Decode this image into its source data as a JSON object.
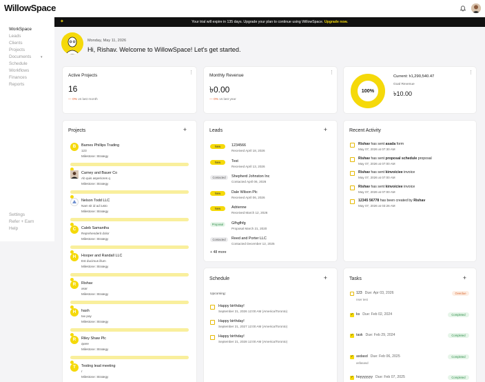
{
  "app": {
    "logo": "WillowSpace"
  },
  "banner": {
    "text": "Your trial will expire in 135 days. Upgrade your plan to continue using WillowSpace.",
    "link": "Upgrade now."
  },
  "sidebar": {
    "items": [
      {
        "label": "WorkSpace"
      },
      {
        "label": "Leads"
      },
      {
        "label": "Clients"
      },
      {
        "label": "Projects"
      },
      {
        "label": "Documents"
      },
      {
        "label": "Schedule"
      },
      {
        "label": "Workflows"
      },
      {
        "label": "Finances"
      },
      {
        "label": "Reports"
      }
    ],
    "bottom": [
      {
        "label": "Settings"
      },
      {
        "label": "Refer + Earn"
      },
      {
        "label": "Help"
      }
    ]
  },
  "welcome": {
    "date": "Monday, May 11, 2026",
    "greeting": "Hi, Rishav. Welcome to WillowSpace! Let's get started."
  },
  "active_projects": {
    "title": "Active Projects",
    "value": "16",
    "delta": "0%",
    "delta_label": "vs last month"
  },
  "monthly_revenue": {
    "title": "Monthly Revenue",
    "value": "৳0.00",
    "delta": "0%",
    "delta_label": "vs last year"
  },
  "goal": {
    "percent_label": "100%",
    "progress": 1.0,
    "current_label": "Current: ৳1,290,540.47",
    "goal_label": "Goal Revenue",
    "goal_value": "৳10.00"
  },
  "projects": {
    "title": "Projects",
    "items": [
      {
        "initial": "B",
        "name": "Barnes Phillips Trading",
        "sub": "123",
        "milestone": "Milestone: Strategy",
        "avatar": "initial"
      },
      {
        "initial": "",
        "name": "Carney and Bauer Co",
        "sub": "Ab quis asperiores q",
        "milestone": "Milestone: Strategy",
        "avatar": "photo"
      },
      {
        "initial": "",
        "name": "Nelson Todd LLC",
        "sub": "Nam sit id ad iusto",
        "milestone": "Milestone: Strategy",
        "avatar": "logo"
      },
      {
        "initial": "C",
        "name": "Caleb Samantha",
        "sub": "Reprehenderit dolor",
        "milestone": "Milestone: Strategy",
        "avatar": "initial"
      },
      {
        "initial": "H",
        "name": "Hooper and Randall LLC",
        "sub": "Est ducimus illum",
        "milestone": "Milestone: Strategy",
        "avatar": "initial"
      },
      {
        "initial": "R",
        "name": "Rishav",
        "sub": "asar",
        "milestone": "Milestone: Strategy",
        "avatar": "initial"
      },
      {
        "initial": "H",
        "name": "hash",
        "sub": "tax pay",
        "milestone": "Milestone: Strategy",
        "avatar": "initial"
      },
      {
        "initial": "R",
        "name": "Riley Shaw Plc",
        "sub": "qwee",
        "milestone": "Milestone: Strategy",
        "avatar": "initial"
      },
      {
        "initial": "T",
        "name": "Testing lead meeting",
        "sub": "r",
        "milestone": "Milestone: Strategy",
        "avatar": "initial"
      }
    ]
  },
  "leads": {
    "title": "Leads",
    "more": "+ 48 more",
    "items": [
      {
        "status": "New",
        "kind": "new",
        "name": "1234566",
        "sub": "Received April 18, 2026"
      },
      {
        "status": "New",
        "kind": "new",
        "name": "Test",
        "sub": "Received April 13, 2026"
      },
      {
        "status": "Contacted",
        "kind": "contacted",
        "name": "Shepherd Johnston Inc",
        "sub": "Contacted April 06, 2026"
      },
      {
        "status": "New",
        "kind": "new",
        "name": "Dale Wilson Plc",
        "sub": "Received April 06, 2026"
      },
      {
        "status": "New",
        "kind": "new",
        "name": "Adrienne",
        "sub": "Received March 12, 2026"
      },
      {
        "status": "Proposal",
        "kind": "proposal",
        "name": "Gfhgfhfg",
        "sub": "Proposal March 21, 2020"
      },
      {
        "status": "Contacted",
        "kind": "contacted",
        "name": "Reed and Porter LLC",
        "sub": "Contacted December 12, 2025"
      }
    ]
  },
  "activity": {
    "title": "Recent Activity",
    "items": [
      {
        "who": "Rishav",
        "verb": " has sent ",
        "what": "asada",
        "rest": " form",
        "when": "May 07, 2026 at 07:30 AM"
      },
      {
        "who": "Rishav",
        "verb": " has sent ",
        "what": "proposal schedule",
        "rest": " proposal",
        "when": "May 07, 2026 at 07:00 AM"
      },
      {
        "who": "Rishav",
        "verb": " has sent ",
        "what": "kinvoiciee",
        "rest": " invoice",
        "when": "May 07, 2026 at 07:00 AM"
      },
      {
        "who": "Rishav",
        "verb": " has sent ",
        "what": "kinvoiciee",
        "rest": " invoice",
        "when": "May 07, 2026 at 07:00 AM"
      },
      {
        "who": "12345 56778",
        "verb": " has been created by ",
        "what": "Rishav",
        "rest": "",
        "when": "May 07, 2026 at 03:26 AM"
      }
    ]
  },
  "schedule": {
    "title": "Schedule",
    "upcoming_label": "Upcoming:",
    "items": [
      {
        "title": "Happy birthday!",
        "when": "September 21, 2026 12:00 AM (America/Toronto)"
      },
      {
        "title": "Happy birthday!",
        "when": "September 21, 2027 12:00 AM (America/Toronto)"
      },
      {
        "title": "Happy birthday!",
        "when": "September 21, 2028 12:00 AM (America/Toronto)"
      }
    ]
  },
  "tasks": {
    "title": "Tasks",
    "items": [
      {
        "name": "123",
        "due": "Due: Apr 03, 2026",
        "sub": "nser test",
        "status": "Overdue",
        "kind": "overdue",
        "done": false
      },
      {
        "name": "ks",
        "due": "Due: Feb 02, 2024",
        "sub": "",
        "status": "Completed",
        "kind": "completed",
        "done": true
      },
      {
        "name": "task",
        "due": "Due: Feb 29, 2024",
        "sub": "",
        "status": "Completed",
        "kind": "completed",
        "done": true
      },
      {
        "name": "asdasd",
        "due": "Due: Feb 06, 2025",
        "sub": "asfasasd",
        "status": "Completed",
        "kind": "completed",
        "done": true
      },
      {
        "name": "hoyyyyyyy",
        "due": "Due: Feb 07, 2025",
        "sub": "",
        "status": "Completed",
        "kind": "completed",
        "done": true
      }
    ]
  },
  "colors": {
    "accent": "#f5d90a",
    "banner_bg": "#111111",
    "negative": "#e25b2a",
    "completed": "#2f8f4a",
    "overdue": "#d8662d"
  }
}
